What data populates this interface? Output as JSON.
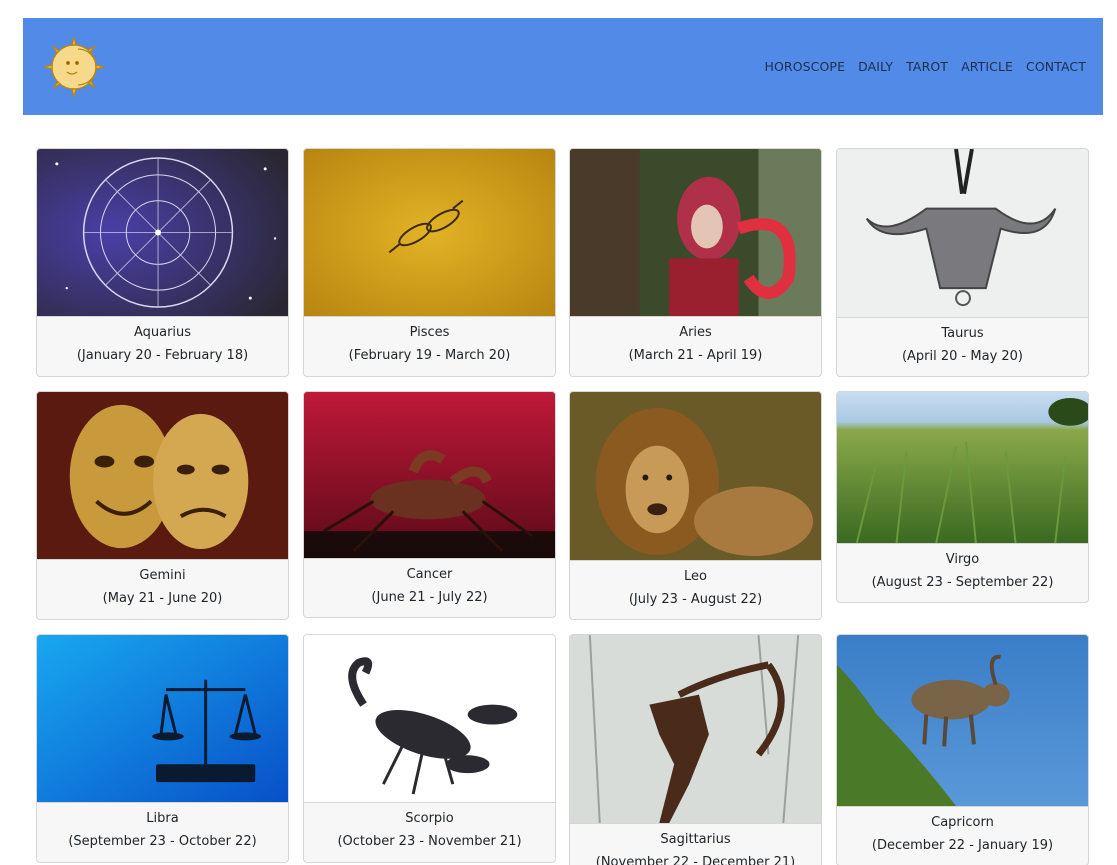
{
  "nav": {
    "logo": "sun-moon-logo",
    "links": [
      "HOROSCOPE",
      "DAILY",
      "TAROT",
      "ARTICLE",
      "CONTACT"
    ]
  },
  "signs": [
    {
      "name": "Aquarius",
      "dates": "(January 20 - February 18)",
      "image": "zodiac-wheel-image"
    },
    {
      "name": "Pisces",
      "dates": "(February 19 - March 20)",
      "image": "pisces-fish-image"
    },
    {
      "name": "Aries",
      "dates": "(March 21 - April 19)",
      "image": "aries-costume-woman-image"
    },
    {
      "name": "Taurus",
      "dates": "(April 20 - May 20)",
      "image": "bull-skull-pendant-image"
    },
    {
      "name": "Gemini",
      "dates": "(May 21 - June 20)",
      "image": "theatre-masks-image"
    },
    {
      "name": "Cancer",
      "dates": "(June 21 - July 22)",
      "image": "crab-image"
    },
    {
      "name": "Leo",
      "dates": "(July 23 - August 22)",
      "image": "lion-image"
    },
    {
      "name": "Virgo",
      "dates": "(August 23 - September 22)",
      "image": "wheat-field-image"
    },
    {
      "name": "Libra",
      "dates": "(September 23 - October 22)",
      "image": "scales-image"
    },
    {
      "name": "Scorpio",
      "dates": "(October 23 - November 21)",
      "image": "scorpion-image"
    },
    {
      "name": "Sagittarius",
      "dates": "(November 22 - December 21)",
      "image": "archer-sculpture-image"
    },
    {
      "name": "Capricorn",
      "dates": "(December 22 - January 19)",
      "image": "ibex-image"
    }
  ]
}
